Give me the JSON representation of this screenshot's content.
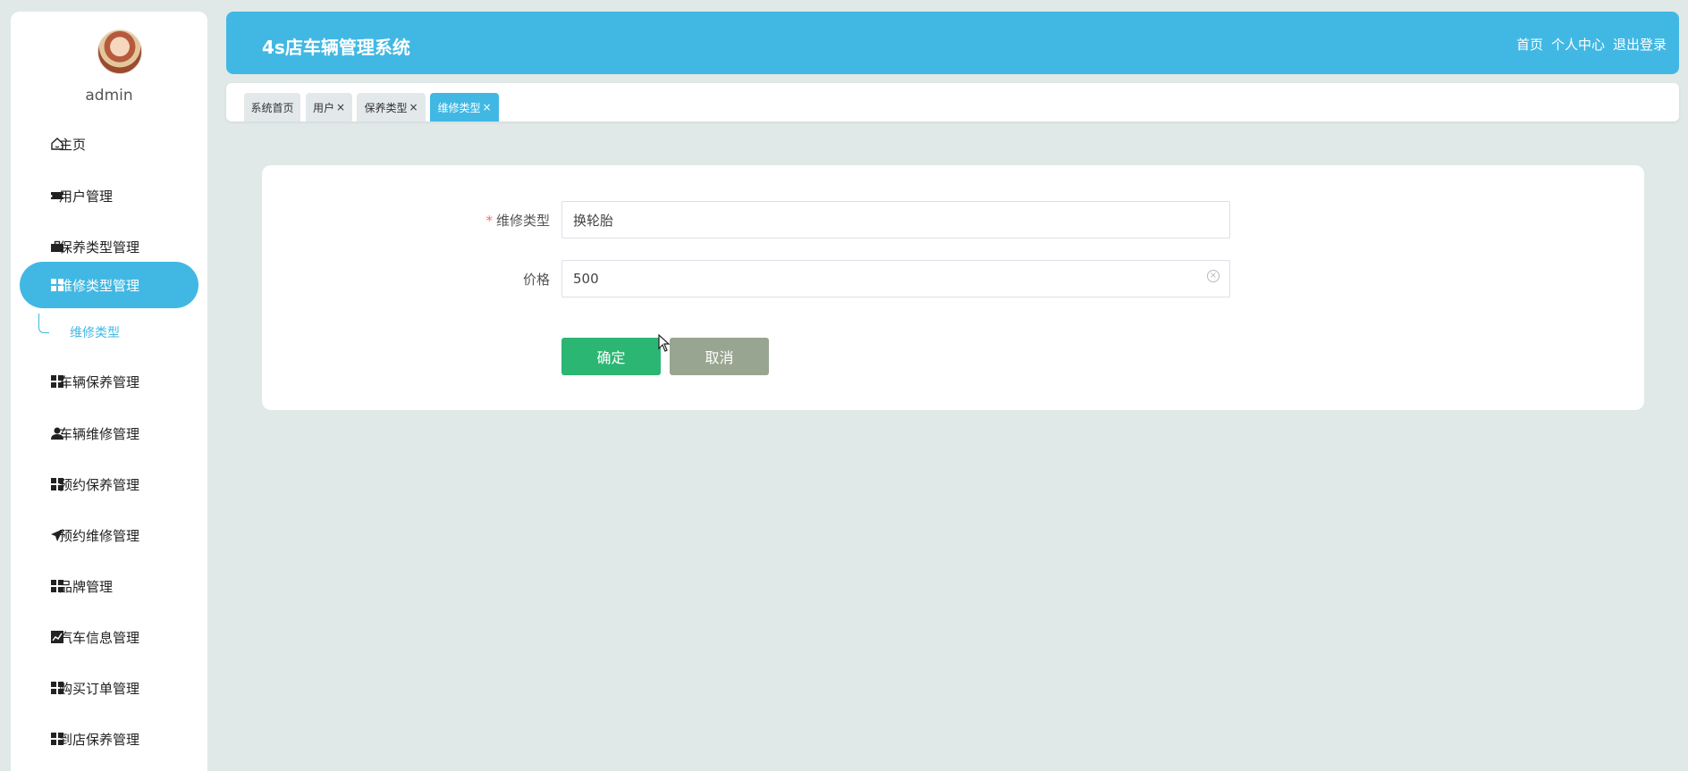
{
  "sidebar": {
    "username": "admin",
    "items": [
      {
        "label": "主页",
        "icon": "home-icon"
      },
      {
        "label": "用户管理",
        "icon": "ticket-icon"
      },
      {
        "label": "保养类型管理",
        "icon": "briefcase-icon"
      },
      {
        "label": "维修类型管理",
        "icon": "grid-icon"
      },
      {
        "label": "车辆保养管理",
        "icon": "grid-icon"
      },
      {
        "label": "车辆维修管理",
        "icon": "user-icon"
      },
      {
        "label": "预约保养管理",
        "icon": "grid-icon"
      },
      {
        "label": "预约维修管理",
        "icon": "send-icon"
      },
      {
        "label": "品牌管理",
        "icon": "grid-icon"
      },
      {
        "label": "汽车信息管理",
        "icon": "chart-icon"
      },
      {
        "label": "购买订单管理",
        "icon": "grid-icon"
      },
      {
        "label": "到店保养管理",
        "icon": "grid-icon"
      }
    ],
    "submenu": {
      "label": "维修类型"
    }
  },
  "header": {
    "title": "4s店车辆管理系统",
    "links": [
      "首页",
      "个人中心",
      "退出登录"
    ]
  },
  "tabs": [
    {
      "label": "系统首页",
      "closable": false
    },
    {
      "label": "用户",
      "closable": true
    },
    {
      "label": "保养类型",
      "closable": true
    },
    {
      "label": "维修类型",
      "closable": true
    }
  ],
  "tab_close_glyph": "×",
  "form": {
    "required_mark": "*",
    "type_label": "维修类型",
    "type_value": "换轮胎",
    "price_label": "价格",
    "price_value": "500",
    "confirm_label": "确定",
    "cancel_label": "取消"
  },
  "colors": {
    "accent": "#41b8e3",
    "confirm": "#2bb673",
    "cancel": "#98a590",
    "background": "#e0e9e8"
  }
}
